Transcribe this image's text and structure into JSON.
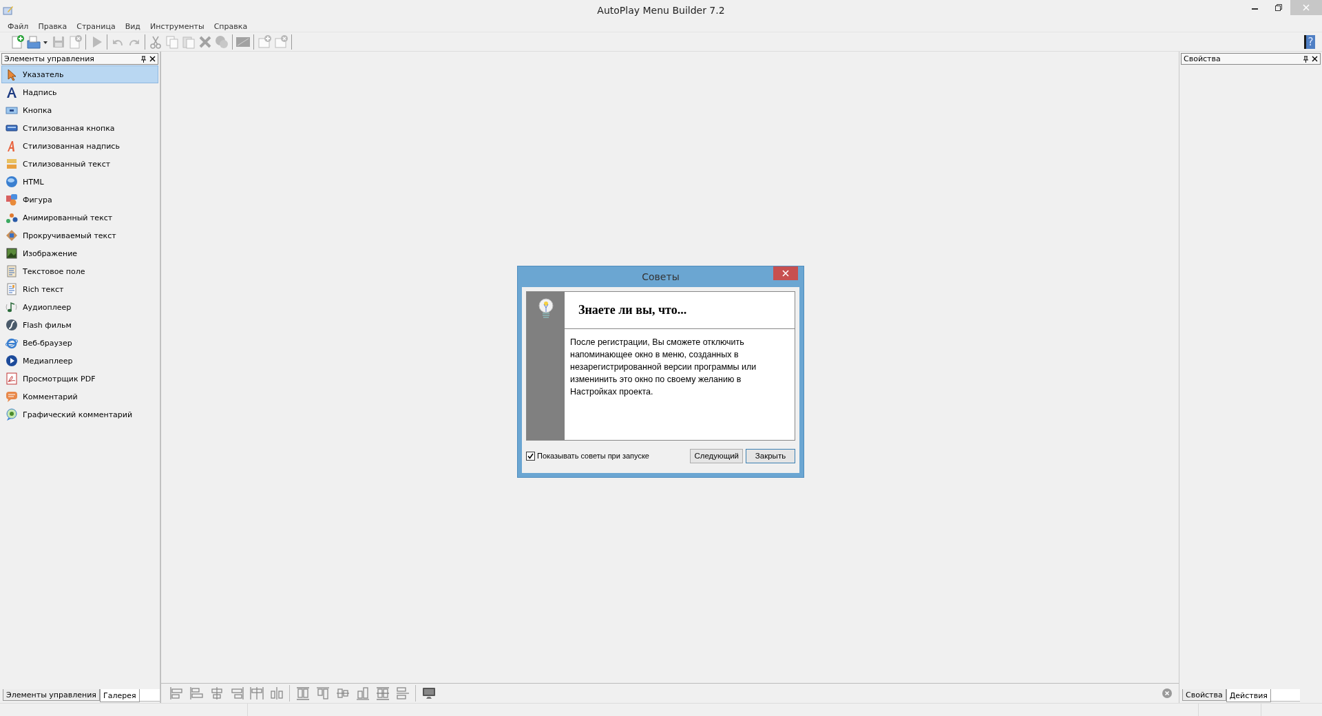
{
  "window": {
    "title": "AutoPlay Menu Builder 7.2"
  },
  "menu": [
    {
      "label": "Файл"
    },
    {
      "label": "Правка"
    },
    {
      "label": "Страница"
    },
    {
      "label": "Вид"
    },
    {
      "label": "Инструменты"
    },
    {
      "label": "Справка"
    }
  ],
  "toolbar": [
    [
      {
        "disabled": false
      },
      {
        "disabled": false
      },
      {
        "disabled": true
      },
      {
        "disabled": true
      }
    ],
    [
      {
        "disabled": true
      }
    ],
    [
      {
        "disabled": true
      },
      {
        "disabled": true
      }
    ],
    [
      {
        "disabled": true
      },
      {
        "disabled": true
      },
      {
        "disabled": true
      },
      {
        "disabled": true
      },
      {
        "disabled": true
      }
    ],
    [
      {
        "disabled": true
      }
    ],
    [
      {
        "disabled": true
      },
      {
        "disabled": true
      }
    ]
  ],
  "help_button": {
    "label": "?"
  },
  "toolbox": {
    "title": "Элементы управления",
    "items": [
      {
        "label": "Указатель",
        "selected": true
      },
      {
        "label": "Надпись",
        "selected": false
      },
      {
        "label": "Кнопка",
        "selected": false
      },
      {
        "label": "Стилизованная кнопка",
        "selected": false
      },
      {
        "label": "Стилизованная надпись",
        "selected": false
      },
      {
        "label": "Стилизованный текст",
        "selected": false
      },
      {
        "label": "HTML",
        "selected": false
      },
      {
        "label": "Фигура",
        "selected": false
      },
      {
        "label": "Анимированный текст",
        "selected": false
      },
      {
        "label": "Прокручиваемый текст",
        "selected": false
      },
      {
        "label": "Изображение",
        "selected": false
      },
      {
        "label": "Текстовое поле",
        "selected": false
      },
      {
        "label": "Rich текст",
        "selected": false
      },
      {
        "label": "Аудиоплеер",
        "selected": false
      },
      {
        "label": "Flash фильм",
        "selected": false
      },
      {
        "label": "Веб-браузер",
        "selected": false
      },
      {
        "label": "Медиаплеер",
        "selected": false
      },
      {
        "label": "Просмотрщик PDF",
        "selected": false
      },
      {
        "label": "Комментарий",
        "selected": false
      },
      {
        "label": "Графический комментарий",
        "selected": false
      }
    ],
    "tabs": [
      {
        "label": "Элементы управления",
        "selected": false
      },
      {
        "label": "Галерея",
        "selected": true
      }
    ]
  },
  "properties_panel": {
    "title": "Свойства",
    "tabs": [
      {
        "label": "Свойства",
        "selected": false
      },
      {
        "label": "Действия",
        "selected": true
      }
    ]
  },
  "dialog": {
    "title": "Советы",
    "heading": "Знаете ли вы, что...",
    "body": "После регистрации, Вы сможете отключить напоминающее окно в меню, созданных в незарегистрированной версии программы или изменинить это окно по своему желанию в Настройках проекта.",
    "show_on_startup": {
      "label": "Показывать советы при запуске",
      "checked": true
    },
    "buttons": [
      {
        "label": "Следующий",
        "default": false
      },
      {
        "label": "Закрыть",
        "default": true
      }
    ]
  }
}
